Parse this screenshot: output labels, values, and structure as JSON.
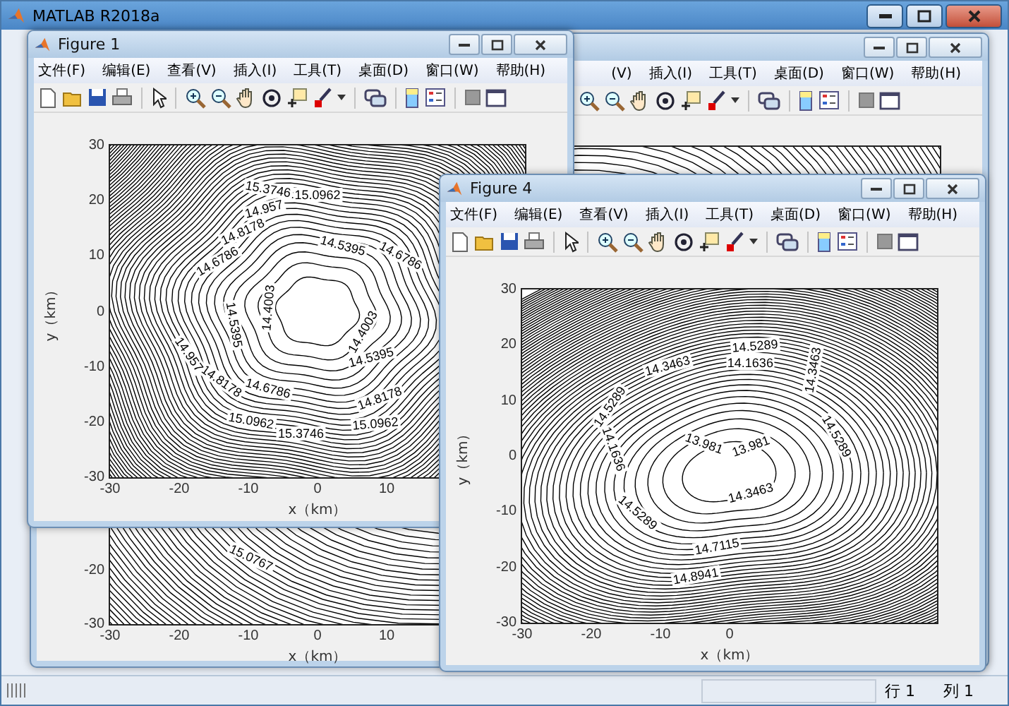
{
  "main_window": {
    "title": "MATLAB R2018a"
  },
  "figures": [
    {
      "menu": [
        "(V)",
        "插入(I)",
        "工具(T)",
        "桌面(D)",
        "窗口(W)",
        "帮助(H)"
      ],
      "plot": {
        "xlabel": "x（km）",
        "y_ticks": [
          "-20",
          "-30"
        ],
        "x_ticks": [
          "-30",
          "-20",
          "-10",
          "0",
          "10"
        ],
        "contour_labels": [
          "15.0767"
        ]
      }
    },
    {
      "title": "Figure 1",
      "menu": [
        "文件(F)",
        "编辑(E)",
        "查看(V)",
        "插入(I)",
        "工具(T)",
        "桌面(D)",
        "窗口(W)",
        "帮助(H)"
      ],
      "plot": {
        "ylabel": "y（km）",
        "xlabel": "x（km）",
        "y_ticks": [
          "30",
          "20",
          "10",
          "0",
          "-10",
          "-20",
          "-30"
        ],
        "x_ticks": [
          "-30",
          "-20",
          "-10",
          "0",
          "10"
        ],
        "contour_labels": [
          "15.3746",
          "15.0962",
          "14.957",
          "14.8178",
          "14.6786",
          "14.5395",
          "14.4003",
          "14.4003",
          "14.5395",
          "14.5395",
          "14.6786",
          "14.8178",
          "14.957",
          "14.8178",
          "15.0962",
          "15.3746",
          "14.6786",
          "15.0962"
        ]
      }
    },
    {
      "title": "Figure 4",
      "menu": [
        "文件(F)",
        "编辑(E)",
        "查看(V)",
        "插入(I)",
        "工具(T)",
        "桌面(D)",
        "窗口(W)",
        "帮助(H)"
      ],
      "plot": {
        "ylabel": "y（km）",
        "xlabel": "x（km）",
        "y_ticks": [
          "30",
          "20",
          "10",
          "0",
          "-10",
          "-20",
          "-30"
        ],
        "x_ticks": [
          "-30",
          "-20",
          "-10",
          "0"
        ],
        "contour_labels": [
          "14.5289",
          "14.3463",
          "14.1636",
          "14.5289",
          "13.981",
          "13.981",
          "14.1636",
          "14.3463",
          "14.5289",
          "14.3463",
          "14.5289",
          "14.7115",
          "14.8941"
        ]
      }
    }
  ],
  "status_bar": {
    "row": "行 1",
    "column": "列 1"
  }
}
